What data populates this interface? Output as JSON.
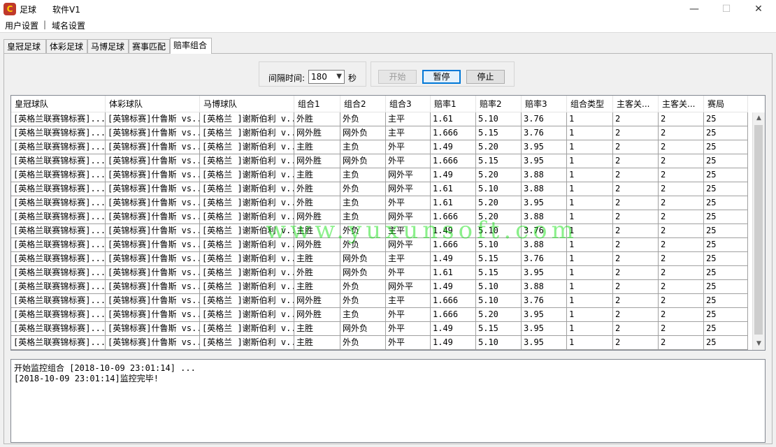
{
  "window": {
    "app_name": "足球",
    "title": "软件V1",
    "minimize": "—",
    "maximize": "☐",
    "close": "✕"
  },
  "menu": {
    "items": [
      "用户设置",
      "域名设置"
    ],
    "separator": "|"
  },
  "tabs": [
    {
      "label": "皇冠足球"
    },
    {
      "label": "体彩足球"
    },
    {
      "label": "马博足球"
    },
    {
      "label": "赛事匹配"
    },
    {
      "label": "赔率组合"
    }
  ],
  "controls": {
    "interval_label": "间隔时间:",
    "interval_value": "180",
    "interval_unit": "秒",
    "start_label": "开始",
    "pause_label": "暂停",
    "stop_label": "停止"
  },
  "table": {
    "columns": [
      "皇冠球队",
      "体彩球队",
      "马博球队",
      "组合1",
      "组合2",
      "组合3",
      "赔率1",
      "赔率2",
      "赔率3",
      "组合类型",
      "主客关...",
      "主客关...",
      "赛局"
    ],
    "rows": [
      [
        "[英格兰联赛锦标赛]...",
        "[英锦标赛]什鲁斯 vs...",
        "[英格兰 ]谢斯伯利 v...",
        "外胜",
        "外负",
        "主平",
        "1.61",
        "5.10",
        "3.76",
        "1",
        "2",
        "2",
        "25"
      ],
      [
        "[英格兰联赛锦标赛]...",
        "[英锦标赛]什鲁斯 vs...",
        "[英格兰 ]谢斯伯利 v...",
        "网外胜",
        "网外负",
        "主平",
        "1.666",
        "5.15",
        "3.76",
        "1",
        "2",
        "2",
        "25"
      ],
      [
        "[英格兰联赛锦标赛]...",
        "[英锦标赛]什鲁斯 vs...",
        "[英格兰 ]谢斯伯利 v...",
        "主胜",
        "主负",
        "外平",
        "1.49",
        "5.20",
        "3.95",
        "1",
        "2",
        "2",
        "25"
      ],
      [
        "[英格兰联赛锦标赛]...",
        "[英锦标赛]什鲁斯 vs...",
        "[英格兰 ]谢斯伯利 v...",
        "网外胜",
        "网外负",
        "外平",
        "1.666",
        "5.15",
        "3.95",
        "1",
        "2",
        "2",
        "25"
      ],
      [
        "[英格兰联赛锦标赛]...",
        "[英锦标赛]什鲁斯 vs...",
        "[英格兰 ]谢斯伯利 v...",
        "主胜",
        "主负",
        "网外平",
        "1.49",
        "5.20",
        "3.88",
        "1",
        "2",
        "2",
        "25"
      ],
      [
        "[英格兰联赛锦标赛]...",
        "[英锦标赛]什鲁斯 vs...",
        "[英格兰 ]谢斯伯利 v...",
        "外胜",
        "外负",
        "网外平",
        "1.61",
        "5.10",
        "3.88",
        "1",
        "2",
        "2",
        "25"
      ],
      [
        "[英格兰联赛锦标赛]...",
        "[英锦标赛]什鲁斯 vs...",
        "[英格兰 ]谢斯伯利 v...",
        "外胜",
        "主负",
        "外平",
        "1.61",
        "5.20",
        "3.95",
        "1",
        "2",
        "2",
        "25"
      ],
      [
        "[英格兰联赛锦标赛]...",
        "[英锦标赛]什鲁斯 vs...",
        "[英格兰 ]谢斯伯利 v...",
        "网外胜",
        "主负",
        "网外平",
        "1.666",
        "5.20",
        "3.88",
        "1",
        "2",
        "2",
        "25"
      ],
      [
        "[英格兰联赛锦标赛]...",
        "[英锦标赛]什鲁斯 vs...",
        "[英格兰 ]谢斯伯利 v...",
        "主胜",
        "外负",
        "主平",
        "1.49",
        "5.10",
        "3.76",
        "1",
        "2",
        "2",
        "25"
      ],
      [
        "[英格兰联赛锦标赛]...",
        "[英锦标赛]什鲁斯 vs...",
        "[英格兰 ]谢斯伯利 v...",
        "网外胜",
        "外负",
        "网外平",
        "1.666",
        "5.10",
        "3.88",
        "1",
        "2",
        "2",
        "25"
      ],
      [
        "[英格兰联赛锦标赛]...",
        "[英锦标赛]什鲁斯 vs...",
        "[英格兰 ]谢斯伯利 v...",
        "主胜",
        "网外负",
        "主平",
        "1.49",
        "5.15",
        "3.76",
        "1",
        "2",
        "2",
        "25"
      ],
      [
        "[英格兰联赛锦标赛]...",
        "[英锦标赛]什鲁斯 vs...",
        "[英格兰 ]谢斯伯利 v...",
        "外胜",
        "网外负",
        "外平",
        "1.61",
        "5.15",
        "3.95",
        "1",
        "2",
        "2",
        "25"
      ],
      [
        "[英格兰联赛锦标赛]...",
        "[英锦标赛]什鲁斯 vs...",
        "[英格兰 ]谢斯伯利 v...",
        "主胜",
        "外负",
        "网外平",
        "1.49",
        "5.10",
        "3.88",
        "1",
        "2",
        "2",
        "25"
      ],
      [
        "[英格兰联赛锦标赛]...",
        "[英锦标赛]什鲁斯 vs...",
        "[英格兰 ]谢斯伯利 v...",
        "网外胜",
        "外负",
        "主平",
        "1.666",
        "5.10",
        "3.76",
        "1",
        "2",
        "2",
        "25"
      ],
      [
        "[英格兰联赛锦标赛]...",
        "[英锦标赛]什鲁斯 vs...",
        "[英格兰 ]谢斯伯利 v...",
        "网外胜",
        "主负",
        "外平",
        "1.666",
        "5.20",
        "3.95",
        "1",
        "2",
        "2",
        "25"
      ],
      [
        "[英格兰联赛锦标赛]...",
        "[英锦标赛]什鲁斯 vs...",
        "[英格兰 ]谢斯伯利 v...",
        "主胜",
        "网外负",
        "外平",
        "1.49",
        "5.15",
        "3.95",
        "1",
        "2",
        "2",
        "25"
      ],
      [
        "[英格兰联赛锦标赛]...",
        "[英锦标赛]什鲁斯 vs...",
        "[英格兰 ]谢斯伯利 v...",
        "主胜",
        "外负",
        "外平",
        "1.49",
        "5.10",
        "3.95",
        "1",
        "2",
        "2",
        "25"
      ]
    ]
  },
  "log": {
    "lines": [
      "开始监控组合 [2018-10-09 23:01:14] ...",
      "[2018-10-09 23:01:14]监控完毕!"
    ]
  },
  "watermark": "www.yuxunsoft.com"
}
